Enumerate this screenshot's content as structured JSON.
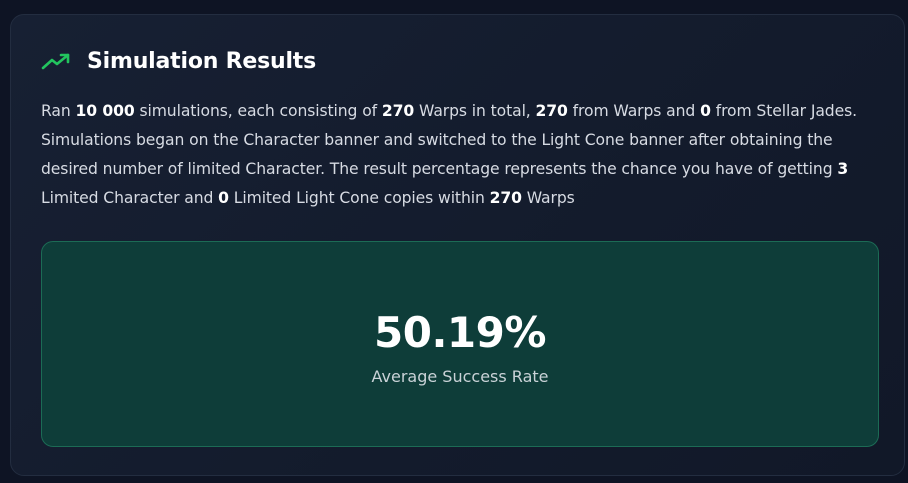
{
  "header": {
    "icon": "trending-up-icon",
    "title": "Simulation Results",
    "accent_color": "#22c55e"
  },
  "description": {
    "p1": "Ran ",
    "simulations": "10 000",
    "p2": " simulations, each consisting of ",
    "total_warps": "270",
    "p3": " Warps in total, ",
    "warps_from_warps": "270",
    "p4": " from Warps and ",
    "from_jades": "0",
    "p5": " from Stellar Jades. Simulations began on the Character banner and switched to the Light Cone banner after obtaining the desired number of limited Character. The result percentage represents the chance you have of getting ",
    "limited_character": "3",
    "p6": " Limited Character and ",
    "limited_light_cone": "0",
    "p7": " Limited Light Cone copies within ",
    "within_warps": "270",
    "p8": " Warps"
  },
  "result": {
    "percentage": "50.19%",
    "label": "Average Success Rate"
  }
}
